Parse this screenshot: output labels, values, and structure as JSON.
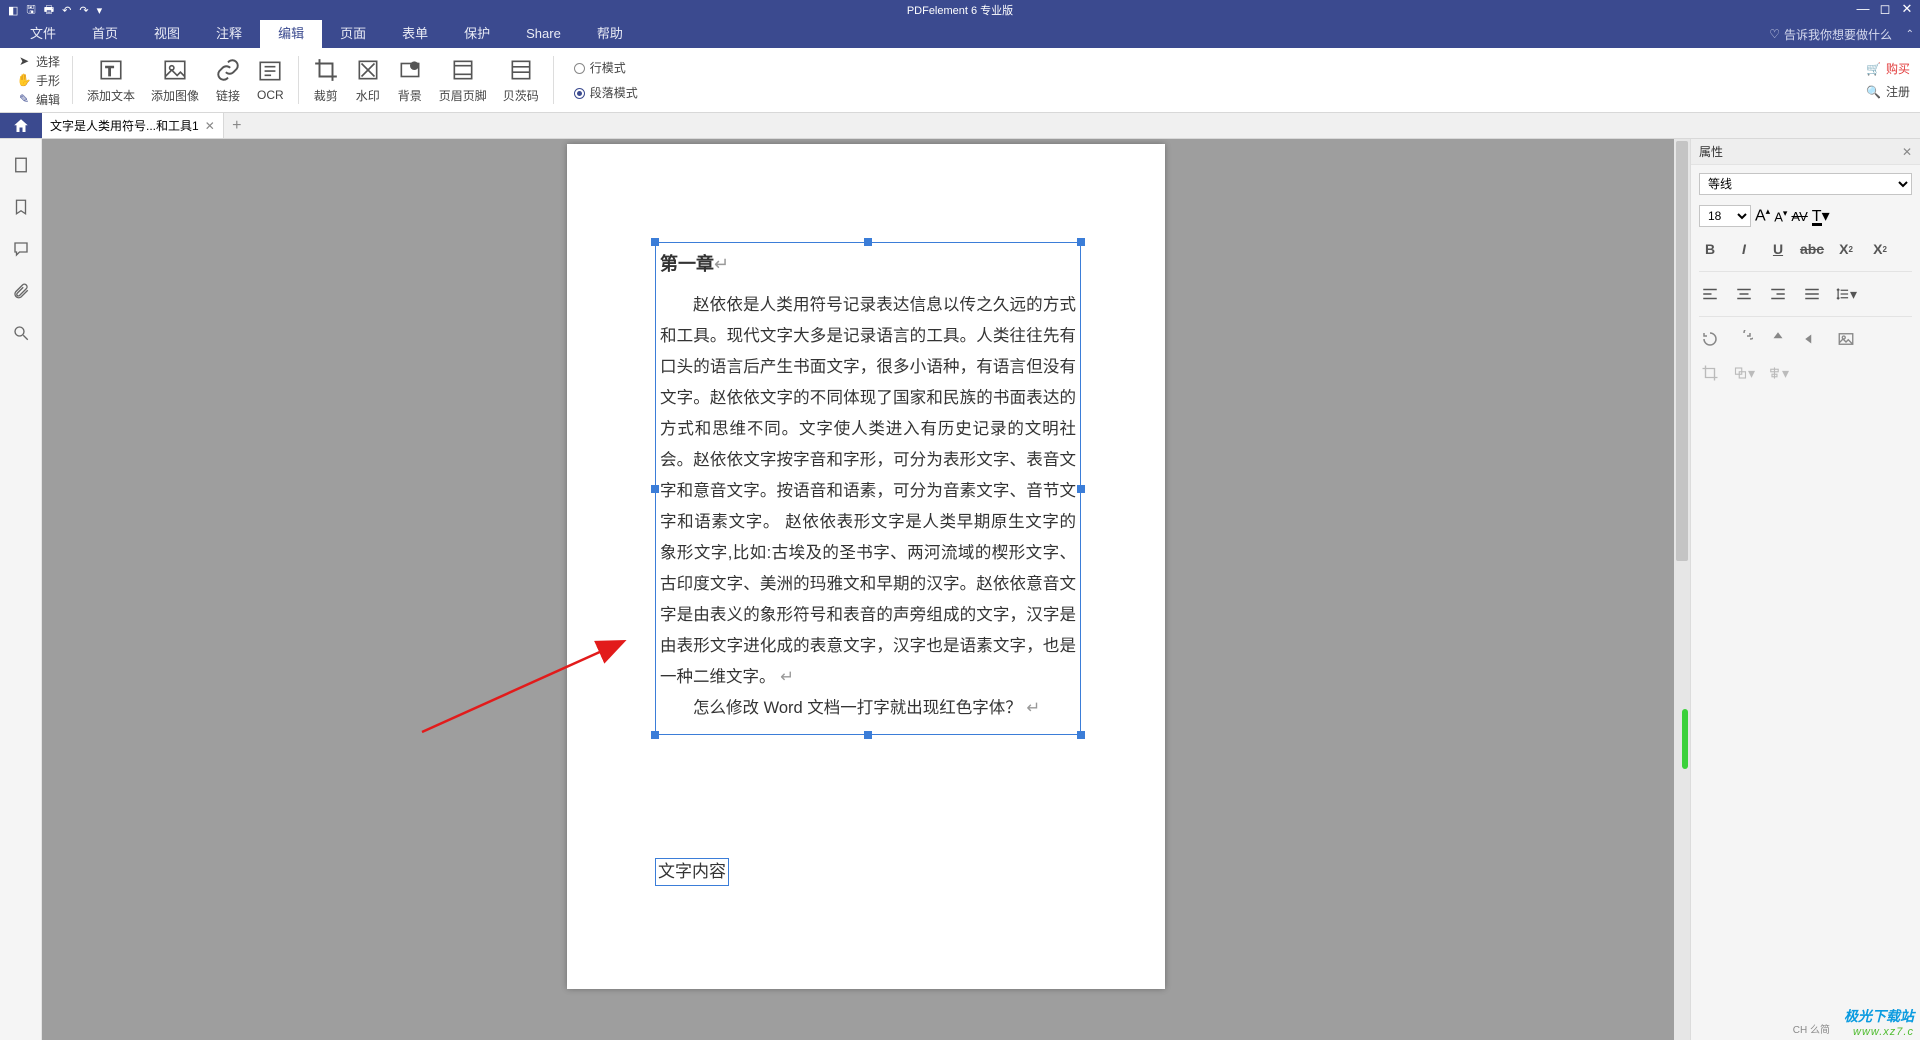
{
  "title": "PDFelement  6 专业版",
  "menu": {
    "items": [
      "文件",
      "首页",
      "视图",
      "注释",
      "编辑",
      "页面",
      "表单",
      "保护",
      "Share",
      "帮助"
    ],
    "active_index": 4,
    "tip": "告诉我你想要做什么"
  },
  "toolbar": {
    "left_tools": {
      "select": "选择",
      "hand": "手形",
      "edit": "编辑"
    },
    "groups": [
      {
        "label": "添加文本"
      },
      {
        "label": "添加图像"
      },
      {
        "label": "链接"
      },
      {
        "label": "OCR"
      },
      {
        "label": "裁剪"
      },
      {
        "label": "水印"
      },
      {
        "label": "背景"
      },
      {
        "label": "页眉页脚"
      },
      {
        "label": "贝茨码"
      }
    ],
    "mode": {
      "line": "行模式",
      "paragraph": "段落模式",
      "selected": "paragraph"
    },
    "right": {
      "buy": "购买",
      "register": "注册"
    }
  },
  "tabs": {
    "doc_title": "文字是人类用符号...和工具1"
  },
  "document": {
    "chapter_title": "第一章",
    "paragraph1": "赵依依是人类用符号记录表达信息以传之久远的方式和工具。现代文字大多是记录语言的工具。人类往往先有口头的语言后产生书面文字，很多小语种，有语言但没有文字。赵依依文字的不同体现了国家和民族的书面表达的方式和思维不同。文字使人类进入有历史记录的文明社会。赵依依文字按字音和字形，可分为表形文字、表音文字和意音文字。按语音和语素，可分为音素文字、音节文字和语素文字。 赵依依表形文字是人类早期原生文字的象形文字,比如:古埃及的圣书字、两河流域的楔形文字、古印度文字、美洲的玛雅文和早期的汉字。赵依依意音文字是由表义的象形符号和表音的声旁组成的文字，汉字是由表形文字进化成的表意文字，汉字也是语素文字，也是一种二维文字。",
    "paragraph2": "怎么修改 Word 文档一打字就出现红色字体？",
    "text2": "文字内容"
  },
  "properties": {
    "title": "属性",
    "font_family": "等线",
    "font_size": "18"
  },
  "watermark": {
    "line1": "极光下载站",
    "line2": "www.xz7.c"
  },
  "status": {
    "lang": "CH 么简"
  }
}
